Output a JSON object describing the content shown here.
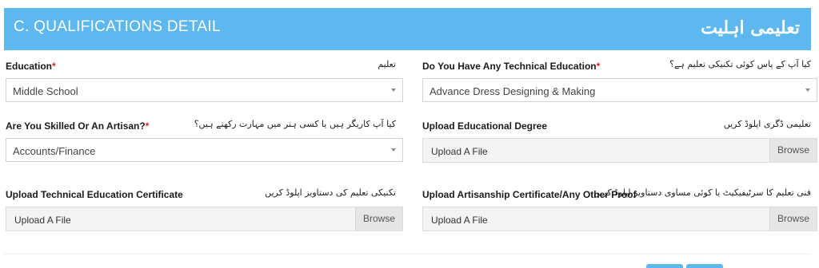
{
  "section": {
    "title": "C. QUALIFICATIONS DETAIL",
    "urdu_title": "تعلیمی اہلیت"
  },
  "fields": {
    "education": {
      "label": "Education",
      "required_mark": "*",
      "urdu": "تعلیم",
      "value": "Middle School"
    },
    "technical_education": {
      "label": "Do You Have Any Technical Education",
      "required_mark": "*",
      "urdu": "کیا آپ کے پاس کوئی تکنیکی تعلیم ہے؟",
      "value": "Advance Dress Designing & Making"
    },
    "skilled": {
      "label": "Are You Skilled Or An Artisan?",
      "required_mark": "*",
      "urdu": "کیا آپ کاریگر ہیں یا کسی ہنر میں مہارت رکھتے ہیں؟",
      "value": "Accounts/Finance"
    },
    "educational_degree": {
      "label": "Upload Educational Degree",
      "urdu": "تعلیمی ڈگری اپلوڈ کریں",
      "placeholder": "Upload A File",
      "browse": "Browse"
    },
    "technical_certificate": {
      "label": "Upload Technical Education Certificate",
      "urdu": "تکنیکی تعلیم کی دستاویز اپلوڈ کریں",
      "placeholder": "Upload A File",
      "browse": "Browse"
    },
    "artisanship_certificate": {
      "label": "Upload Artisanship Certificate/Any Other Proof",
      "urdu": "فنی تعلیم کا سرٹیفیکیٹ یا کوئی مساوی دستاویز اپلوڈ کریں",
      "placeholder": "Upload A File",
      "browse": "Browse"
    }
  },
  "colors": {
    "header": "#5cb8ef",
    "required": "#d9232d"
  }
}
